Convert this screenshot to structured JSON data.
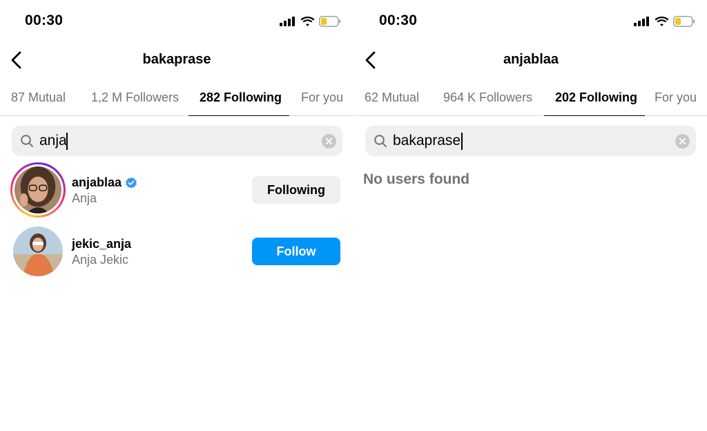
{
  "left_screen": {
    "status": {
      "time": "00:30"
    },
    "header": {
      "title": "bakaprase"
    },
    "tabs": [
      {
        "label": "87 Mutual"
      },
      {
        "label": "1,2 M Followers"
      },
      {
        "label": "282 Following",
        "active": true
      },
      {
        "label": "For you"
      }
    ],
    "search": {
      "value": "anja"
    },
    "users": [
      {
        "username": "anjablaa",
        "full_name": "Anja",
        "verified": true,
        "has_story_ring": true,
        "button": "Following"
      },
      {
        "username": "jekic_anja",
        "full_name": "Anja Jekic",
        "verified": false,
        "has_story_ring": false,
        "button": "Follow"
      }
    ]
  },
  "right_screen": {
    "status": {
      "time": "00:30"
    },
    "header": {
      "title": "anjablaa"
    },
    "tabs": [
      {
        "label": "62 Mutual"
      },
      {
        "label": "964 K Followers"
      },
      {
        "label": "202 Following",
        "active": true
      },
      {
        "label": "For you"
      }
    ],
    "search": {
      "value": "bakaprase"
    },
    "empty_message": "No users found"
  },
  "colors": {
    "primary_blue": "#0095f6",
    "secondary_button": "#efefef",
    "muted_text": "#737373",
    "verified_blue": "#3897f0",
    "battery_low": "#f5c518"
  },
  "icons": [
    "back-chevron-icon",
    "search-icon",
    "clear-icon",
    "verified-badge-icon",
    "cellular-signal-icon",
    "wifi-icon",
    "battery-icon"
  ]
}
